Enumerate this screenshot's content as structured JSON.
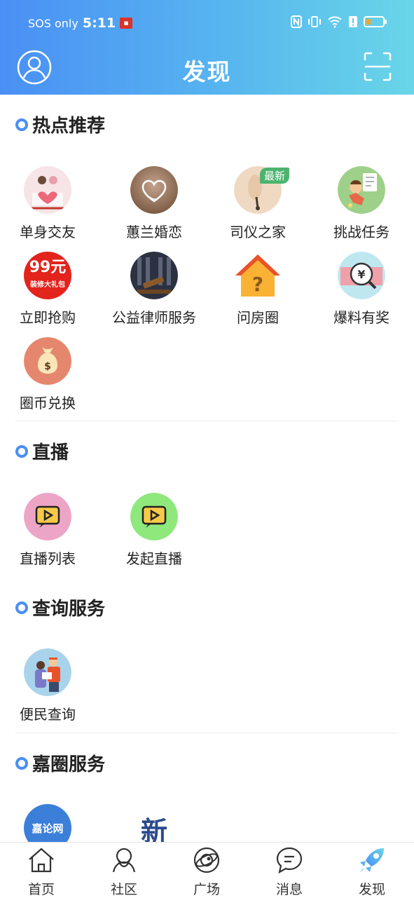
{
  "status_bar": {
    "carrier": "SOS only",
    "time": "5:11"
  },
  "header": {
    "title": "发现"
  },
  "sections": {
    "hot": {
      "title": "热点推荐",
      "items": [
        {
          "label": "单身交友",
          "icon": "love-couple-icon"
        },
        {
          "label": "蕙兰婚恋",
          "icon": "heart-icon"
        },
        {
          "label": "司仪之家",
          "icon": "microphone-icon",
          "badge": "最新"
        },
        {
          "label": "挑战任务",
          "icon": "task-icon"
        },
        {
          "label": "立即抢购",
          "icon": "sale-icon",
          "promo_main": "99元",
          "promo_sub": "装修大礼包"
        },
        {
          "label": "公益律师服务",
          "icon": "gavel-icon"
        },
        {
          "label": "问房圈",
          "icon": "house-question-icon"
        },
        {
          "label": "爆料有奖",
          "icon": "money-icon"
        },
        {
          "label": "圈币兑换",
          "icon": "money-bag-icon"
        }
      ]
    },
    "live": {
      "title": "直播",
      "items": [
        {
          "label": "直播列表",
          "icon": "play-icon"
        },
        {
          "label": "发起直播",
          "icon": "play-icon"
        }
      ]
    },
    "query": {
      "title": "查询服务",
      "items": [
        {
          "label": "便民查询",
          "icon": "people-icon"
        }
      ]
    },
    "circle": {
      "title": "嘉圈服务",
      "items": [
        {
          "label": "",
          "icon": "jialun-logo-icon",
          "logo_text": "嘉论网"
        },
        {
          "label": "",
          "icon": "xin-logo-icon",
          "logo_text": "新"
        }
      ]
    }
  },
  "tabbar": {
    "tabs": [
      {
        "label": "首页",
        "icon": "home-icon"
      },
      {
        "label": "社区",
        "icon": "community-icon"
      },
      {
        "label": "广场",
        "icon": "planet-icon"
      },
      {
        "label": "消息",
        "icon": "message-icon"
      },
      {
        "label": "发现",
        "icon": "rocket-icon",
        "active": true
      }
    ]
  },
  "colors": {
    "header_start": "#4a8ff5",
    "header_end": "#69d6e8",
    "accent": "#4a8ff5"
  }
}
